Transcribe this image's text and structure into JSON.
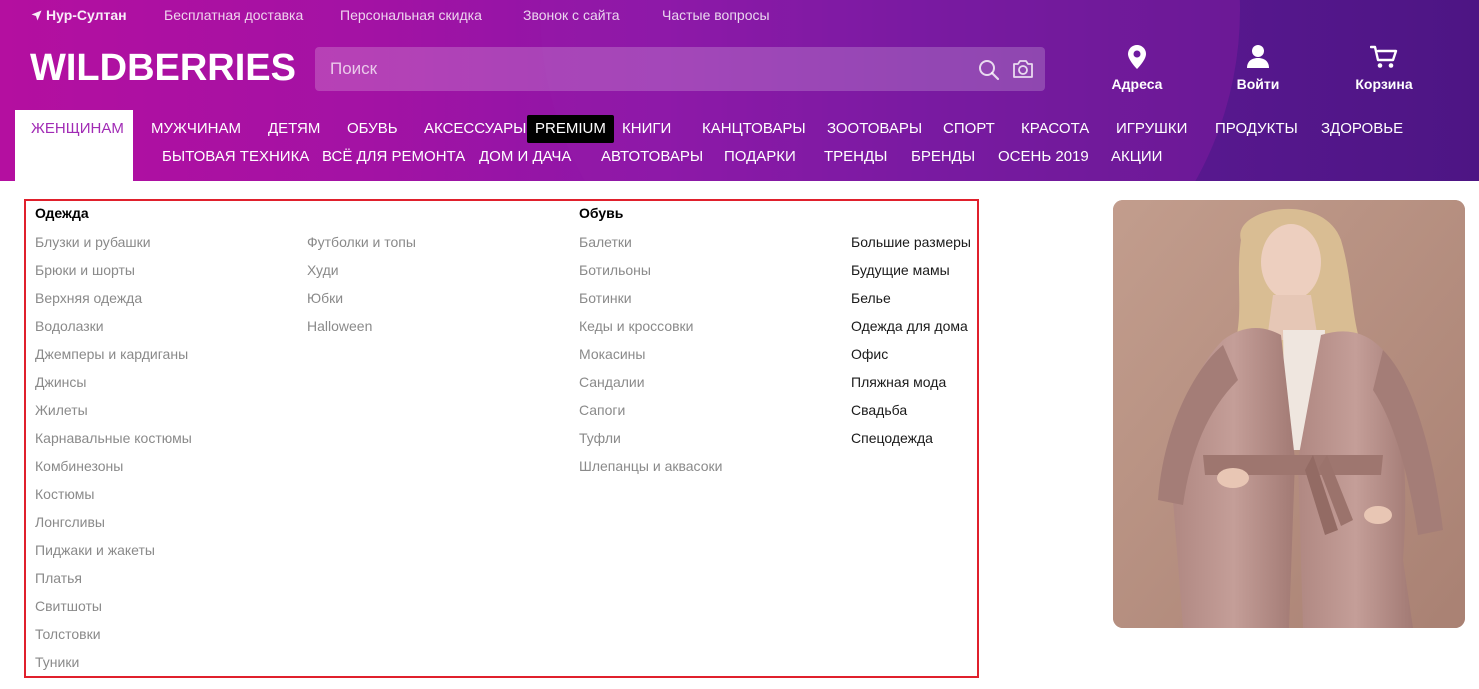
{
  "topbar": {
    "city": "Нур-Султан",
    "links": [
      "Бесплатная доставка",
      "Персональная скидка",
      "Звонок с сайта",
      "Частые вопросы"
    ]
  },
  "logo": "WILDBERRIES",
  "search": {
    "placeholder": "Поиск"
  },
  "actions": {
    "address": "Адреса",
    "login": "Войти",
    "cart": "Корзина"
  },
  "menu": {
    "row1": [
      "ЖЕНЩИНАМ",
      "МУЖЧИНАМ",
      "ДЕТЯМ",
      "ОБУВЬ",
      "АКСЕССУАРЫ",
      "PREMIUM",
      "КНИГИ",
      "КАНЦТОВАРЫ",
      "ЗООТОВАРЫ",
      "СПОРТ",
      "КРАСОТА",
      "ИГРУШКИ",
      "ПРОДУКТЫ",
      "ЗДОРОВЬЕ"
    ],
    "row2": [
      "БЫТОВАЯ ТЕХНИКА",
      "ВСЁ ДЛЯ РЕМОНТА",
      "ДОМ И ДАЧА",
      "АВТОТОВАРЫ",
      "ПОДАРКИ",
      "ТРЕНДЫ",
      "БРЕНДЫ",
      "ОСЕНЬ 2019",
      "АКЦИИ"
    ]
  },
  "dropdown": {
    "clothing": {
      "title": "Одежда",
      "col1": [
        "Блузки и рубашки",
        "Брюки и шорты",
        "Верхняя одежда",
        "Водолазки",
        "Джемперы и кардиганы",
        "Джинсы",
        "Жилеты",
        "Карнавальные костюмы",
        "Комбинезоны",
        "Костюмы",
        "Лонгсливы",
        "Пиджаки и жакеты",
        "Платья",
        "Свитшоты",
        "Толстовки",
        "Туники"
      ],
      "col2": [
        "Футболки и топы",
        "Худи",
        "Юбки",
        "Halloween"
      ]
    },
    "shoes": {
      "title": "Обувь",
      "items": [
        "Балетки",
        "Ботильоны",
        "Ботинки",
        "Кеды и кроссовки",
        "Мокасины",
        "Сандалии",
        "Сапоги",
        "Туфли",
        "Шлепанцы и аквасоки"
      ]
    },
    "extra": [
      "Большие размеры",
      "Будущие мамы",
      "Белье",
      "Одежда для дома",
      "Офис",
      "Пляжная мода",
      "Свадьба",
      "Спецодежда"
    ]
  },
  "colors": {
    "brand_left": "#b40fa0",
    "brand_right": "#4d1584",
    "active_tab_text": "#a12bb5",
    "highlight_border": "#e0202c"
  }
}
